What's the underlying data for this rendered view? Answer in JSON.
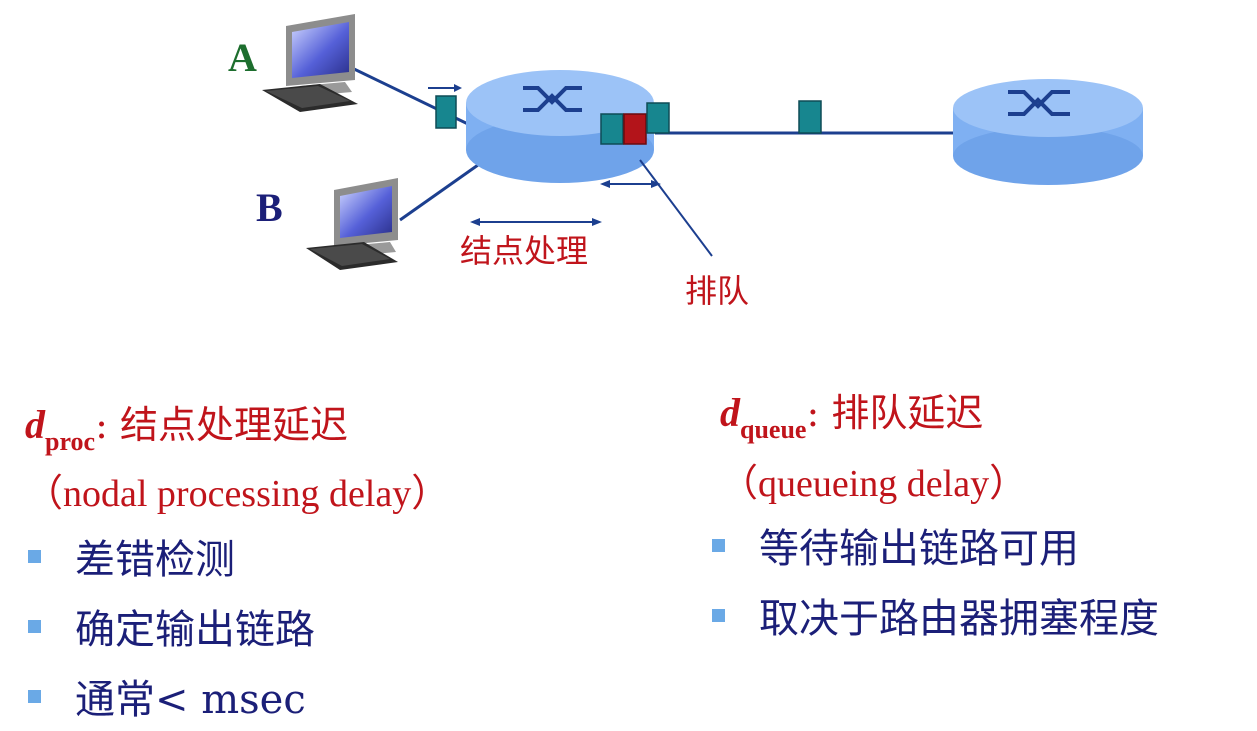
{
  "diagram": {
    "host_a_label": "A",
    "host_b_label": "B",
    "proc_label": "结点处理",
    "queue_label": "排队"
  },
  "left": {
    "symbol": "d",
    "subscript": "proc",
    "title": ": 结点处理延迟",
    "english": "（nodal processing delay）",
    "bullets": [
      "差错检测",
      "确定输出链路",
      "通常< msec"
    ]
  },
  "right": {
    "symbol": "d",
    "subscript": "queue",
    "title": ": 排队延迟",
    "english": "（queueing delay）",
    "bullets": [
      "等待输出链路可用",
      "取决于路由器拥塞程度"
    ]
  },
  "colors": {
    "router": "#7fb0f2",
    "packet": "#17868f",
    "packet_red": "#b3141a",
    "label_red": "#c0141b",
    "text_blue": "#1b1f78",
    "bullet": "#6aa9e6"
  }
}
